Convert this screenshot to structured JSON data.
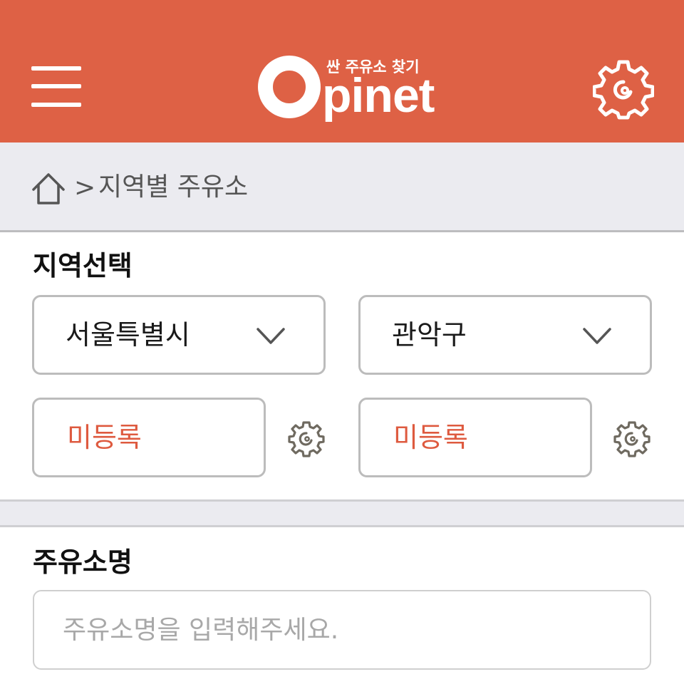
{
  "header": {
    "logo_tagline": "싼 주유소 찾기",
    "logo_text": "pinet",
    "brand_color": "#de6145"
  },
  "breadcrumb": {
    "separator": ">",
    "current": "지역별 주유소"
  },
  "region": {
    "title": "지역선택",
    "city_select": "서울특별시",
    "district_select": "관악구",
    "slot1_value": "미등록",
    "slot2_value": "미등록",
    "unregistered_color": "#de5a3f"
  },
  "station_name": {
    "title": "주유소명",
    "placeholder": "주유소명을 입력해주세요."
  }
}
